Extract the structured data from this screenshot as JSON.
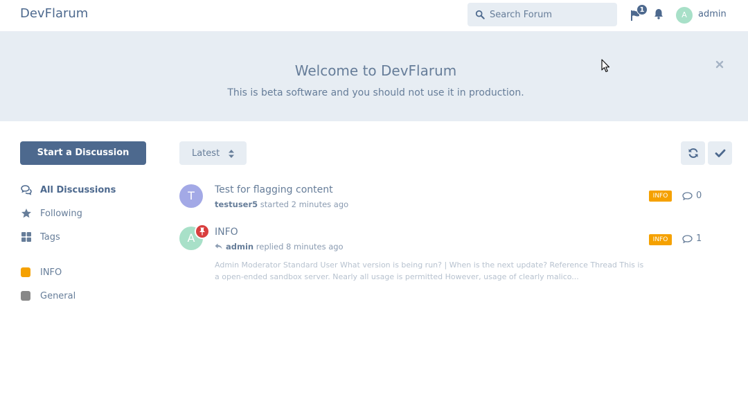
{
  "header": {
    "brand": "DevFlarum",
    "search_placeholder": "Search Forum",
    "flag_count": "1",
    "user": {
      "initial": "A",
      "name": "admin",
      "avatar_color": "#a8e0c8"
    }
  },
  "hero": {
    "title": "Welcome to DevFlarum",
    "subtitle": "This is beta software and you should not use it in production."
  },
  "sidebar": {
    "start_button": "Start a Discussion",
    "nav": [
      {
        "label": "All Discussions",
        "icon": "comments-icon",
        "active": true
      },
      {
        "label": "Following",
        "icon": "star-icon",
        "active": false
      },
      {
        "label": "Tags",
        "icon": "th-large-icon",
        "active": false
      }
    ],
    "tags": [
      {
        "label": "INFO",
        "color": "#f5a100"
      },
      {
        "label": "General",
        "color": "#888888"
      }
    ]
  },
  "toolbar": {
    "sort_label": "Latest",
    "refresh_icon": "refresh-icon",
    "mark_read_icon": "check-icon"
  },
  "discussions": [
    {
      "avatar_initial": "T",
      "avatar_color": "#a3a9e6",
      "title": "Test for flagging content",
      "user": "testuser5",
      "action": " started 2 minutes ago",
      "tag": "INFO",
      "replies": "0",
      "pinned": false,
      "excerpt": ""
    },
    {
      "avatar_initial": "A",
      "avatar_color": "#a8e0c8",
      "title": "INFO",
      "user": "admin",
      "action": " replied 8 minutes ago",
      "tag": "INFO",
      "replies": "1",
      "pinned": true,
      "excerpt": "Admin Moderator Standard User What version is being run? | When is the next update? Reference Thread This is a open-ended sandbox server. Nearly all usage is permitted However, usage of clearly malico..."
    }
  ],
  "colors": {
    "primary": "#4d698e",
    "tag_info": "#f5a100",
    "pin": "#d83e3e"
  }
}
